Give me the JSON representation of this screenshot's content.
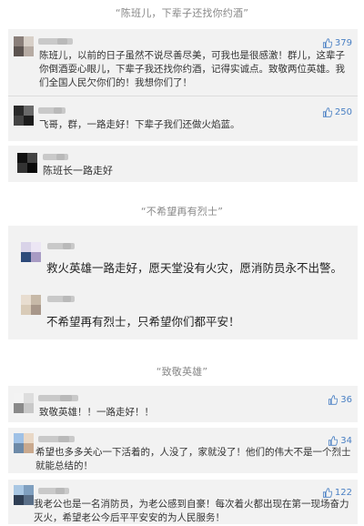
{
  "sections": [
    {
      "title": "“陈班儿，下辈子还找你约酒”"
    },
    {
      "title": "“不希望再有烈士”"
    },
    {
      "title": "“致敬英雄”"
    }
  ],
  "comments": [
    {
      "text": "陈班儿，以前的日子虽然不说尽善尽美，可我也是很感激！群儿，这辈子你倒酒耍心眼儿，下辈子我还找你约酒，记得实诚点。致敬两位英雄。我们全国人民欠你们的！我想你们了！",
      "likes": "379"
    },
    {
      "text": "飞哥，群，一路走好！下辈子我们还做火焰蓝。",
      "likes": "250"
    },
    {
      "text": "陈班长一路走好"
    },
    {
      "text": "救火英雄一路走好，愿天堂没有火灾，愿消防员永不出警。"
    },
    {
      "text": "不希望再有烈士，只希望你们都平安！"
    },
    {
      "text": "致敬英雄！！一路走好！！",
      "likes": "36"
    },
    {
      "text": "希望也多多关心一下活着的，人没了，家就没了！他们的伟大不是一个烈士就能总结的！",
      "likes": "34"
    },
    {
      "text": "我老公也是一名消防员，为老公感到自豪！每次着火都出现在第一现场奋力灭火，希望老公今后平平安安的为人民服务！",
      "likes": "122"
    }
  ],
  "icons": {
    "like": "thumbs-up-icon"
  },
  "colors": {
    "like": "#4a80c4",
    "panel": "#f2f2f2"
  }
}
